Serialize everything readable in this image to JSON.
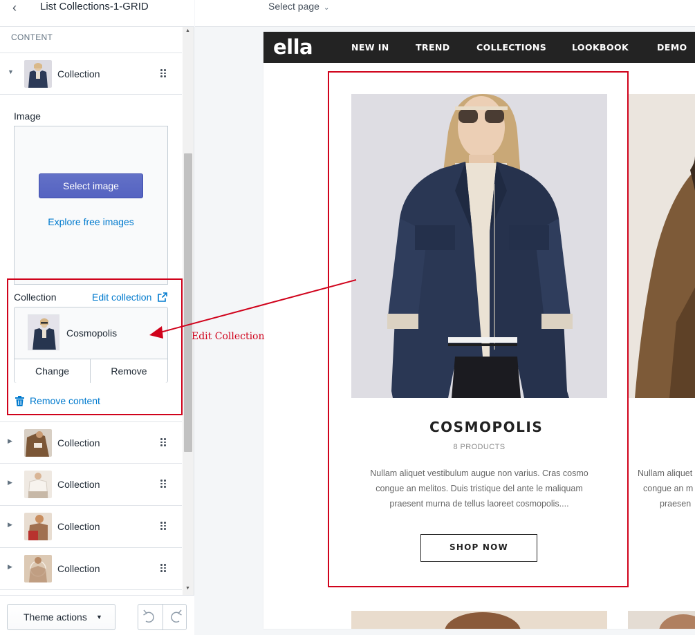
{
  "editor": {
    "title": "List Collections-1-GRID",
    "section_label": "CONTENT",
    "block_label": "Collection",
    "image_setting": {
      "label": "Image",
      "select_button": "Select image",
      "explore_link": "Explore free images"
    },
    "collection_setting": {
      "label": "Collection",
      "edit_link": "Edit collection",
      "selected_name": "Cosmopolis",
      "change_button": "Change",
      "remove_button": "Remove"
    },
    "remove_content": "Remove content",
    "blocks": [
      {
        "label": "Collection",
        "expanded": true
      },
      {
        "label": "Collection",
        "expanded": false
      },
      {
        "label": "Collection",
        "expanded": false
      },
      {
        "label": "Collection",
        "expanded": false
      },
      {
        "label": "Collection",
        "expanded": false
      }
    ],
    "footer": {
      "theme_actions": "Theme actions"
    }
  },
  "topbar": {
    "select_page": "Select page"
  },
  "store": {
    "logo": "ella",
    "nav": [
      "NEW IN",
      "TREND",
      "COLLECTIONS",
      "LOOKBOOK",
      "DEMO"
    ],
    "card": {
      "title": "COSMOPOLIS",
      "count": "8 PRODUCTS",
      "description_lines": [
        "Nullam aliquet vestibulum augue non varius. Cras cosmo",
        "congue an melitos. Duis tristique del ante le maliquam",
        "praesent murna de tellus laoreet cosmopolis...."
      ],
      "button": "SHOP NOW"
    },
    "next_card_desc_lines": [
      "Nullam aliquet",
      "congue an m",
      "praesen"
    ]
  },
  "annotation": {
    "label": "Edit Collection",
    "color": "#d0021b"
  },
  "colors": {
    "primary_button": "#5c6ac4",
    "link": "#007ace",
    "nav_bg": "#232323"
  }
}
